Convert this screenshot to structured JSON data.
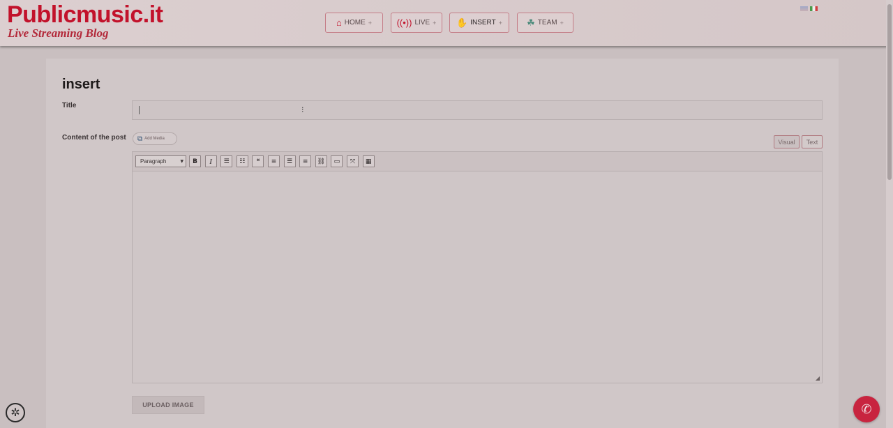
{
  "site": {
    "logo": "Publicmusic.it",
    "tagline": "Live Streaming Blog"
  },
  "nav": [
    {
      "label": "HOME",
      "icon": "home-icon",
      "plus": "+"
    },
    {
      "label": "LIVE",
      "icon": "broadcast-icon",
      "plus": "+"
    },
    {
      "label": "INSERT",
      "icon": "rock-hand-icon",
      "plus": "+"
    },
    {
      "label": "TEAM",
      "icon": "team-icon",
      "plus": "+"
    }
  ],
  "languages": [
    "en-flag-icon",
    "it-flag-icon"
  ],
  "form": {
    "page_title": "insert",
    "title_label": "Title",
    "title_value": "",
    "content_label": "Content of the post",
    "add_media": "Add Media",
    "tab_visual": "Visual",
    "tab_text": "Text",
    "format_select": "Paragraph",
    "toolbar": [
      {
        "name": "bold-button",
        "glyph": "B"
      },
      {
        "name": "italic-button",
        "glyph": "I"
      },
      {
        "name": "bullet-list-button",
        "glyph": "☰"
      },
      {
        "name": "numbered-list-button",
        "glyph": "☷"
      },
      {
        "name": "blockquote-button",
        "glyph": "❝"
      },
      {
        "name": "align-left-button",
        "glyph": "≡"
      },
      {
        "name": "align-center-button",
        "glyph": "☰"
      },
      {
        "name": "align-right-button",
        "glyph": "≡"
      },
      {
        "name": "link-button",
        "glyph": "⛓"
      },
      {
        "name": "read-more-button",
        "glyph": "▭"
      },
      {
        "name": "fullscreen-button",
        "glyph": "⤧"
      },
      {
        "name": "toolbar-toggle-button",
        "glyph": "▦"
      }
    ],
    "upload_button": "UPLOAD IMAGE"
  },
  "colors": {
    "brand": "#c2122b",
    "whatsapp": "#c8243f"
  }
}
